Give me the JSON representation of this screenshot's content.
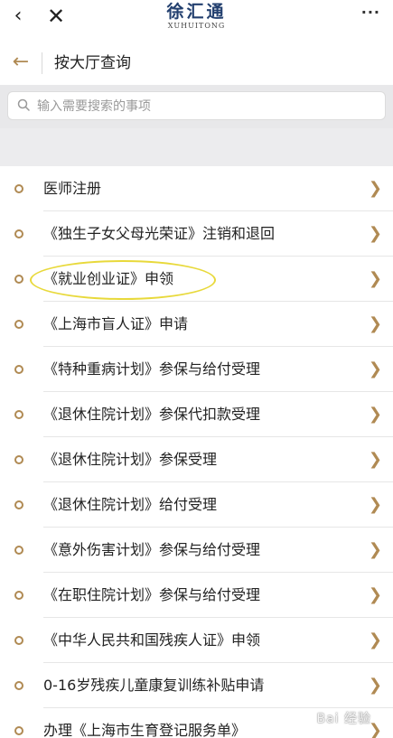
{
  "topbar": {
    "back_icon": "chevron-left-icon",
    "close_icon": "close-icon",
    "brand_cn": "徐汇通",
    "brand_en": "XUHUITONG",
    "more": "···"
  },
  "header": {
    "title": "按大厅查询"
  },
  "search": {
    "placeholder": "输入需要搜索的事项",
    "value": ""
  },
  "items": [
    {
      "label": "医师注册"
    },
    {
      "label": "《独生子女父母光荣证》注销和退回"
    },
    {
      "label": "《就业创业证》申领"
    },
    {
      "label": "《上海市盲人证》申请"
    },
    {
      "label": "《特种重病计划》参保与给付受理"
    },
    {
      "label": "《退休住院计划》参保代扣款受理"
    },
    {
      "label": "《退休住院计划》参保受理"
    },
    {
      "label": "《退休住院计划》给付受理"
    },
    {
      "label": "《意外伤害计划》参保与给付受理"
    },
    {
      "label": "《在职住院计划》参保与给付受理"
    },
    {
      "label": "《中华人民共和国残疾人证》申领"
    },
    {
      "label": "0-16岁残疾儿童康复训练补贴申请"
    },
    {
      "label": "办理《上海市生育登记服务单》"
    }
  ],
  "colors": {
    "accent": "#b08a53",
    "brand": "#23406f",
    "highlight": "#e8d93b"
  },
  "watermark": "Bai 经验"
}
